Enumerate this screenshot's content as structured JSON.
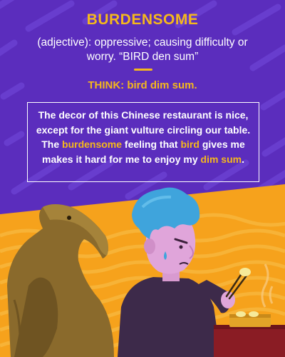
{
  "word": "BURDENSOME",
  "definition": "(adjective): oppressive; causing difficulty or worry. “BIRD den sum”",
  "think": "THINK: bird dim sum.",
  "story": {
    "part1": "The decor of this Chinese restaurant is nice, except for the giant vulture circling our table. The ",
    "highlight1": "burdensome",
    "part2": " feeling that ",
    "highlight2": "bird",
    "part3": " gives me makes it hard for me to enjoy my ",
    "highlight3": "dim sum",
    "part4": "."
  },
  "colors": {
    "purple_bg": "#5b2dbd",
    "purple_stripe": "#6a3fd0",
    "accent_yellow": "#f5b81c",
    "orange_bg": "#f6a21c",
    "text_white": "#ffffff"
  }
}
